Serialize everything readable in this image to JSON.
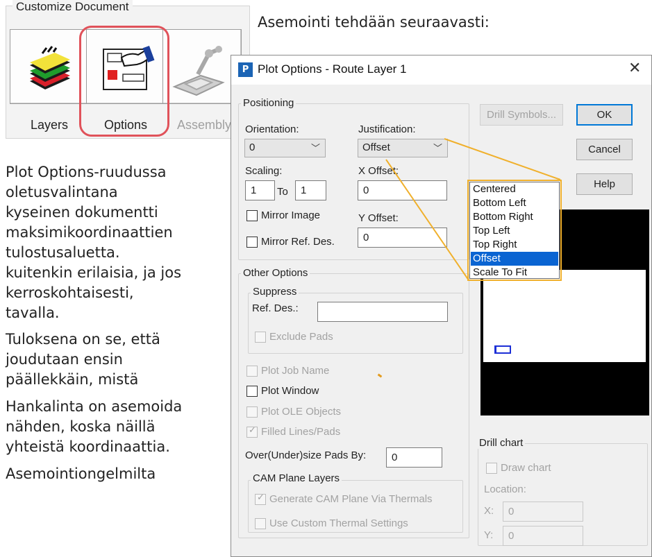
{
  "customize": {
    "title": "Customize Document",
    "buttons": [
      {
        "label": "Layers"
      },
      {
        "label": "Options"
      },
      {
        "label": "Assembly"
      }
    ]
  },
  "heading": "Asemointi tehdään seuraavasti:",
  "body_lines": [
    "Plot Options-ruudussa",
    "oletusvalintana",
    "kyseinen dokumentti",
    "maksimikoordinaattien",
    "tulostusaluetta.",
    "kuitenkin erilaisia, ja jos",
    "kerroskohtaisesti,",
    "tavalla.",
    "Tuloksena on se, että",
    "joudutaan ensin",
    "päällekkäin, mistä",
    "Hankalinta on asemoida",
    "nähden, koska näillä",
    "yhteistä koordinaattia.",
    "Asemointiongelmilta"
  ],
  "dialog": {
    "title": "Plot Options - Route Layer 1",
    "positioning": {
      "title": "Positioning",
      "orientation_label": "Orientation:",
      "orientation_value": "0",
      "justification_label": "Justification:",
      "justification_value": "Offset",
      "scaling_label": "Scaling:",
      "scale_from": "1",
      "to_label": "To",
      "scale_to": "1",
      "x_offset_label": "X Offset:",
      "x_offset_value": "0",
      "y_offset_label": "Y Offset:",
      "y_offset_value": "0",
      "mirror_image": "Mirror Image",
      "mirror_ref_des": "Mirror Ref. Des."
    },
    "other_options": {
      "title": "Other Options",
      "suppress_title": "Suppress",
      "ref_des_label": "Ref. Des.:",
      "ref_des_value": "",
      "exclude_pads": "Exclude Pads",
      "plot_job_name": "Plot Job Name",
      "plot_window": "Plot Window",
      "plot_ole_objects": "Plot OLE Objects",
      "filled_lines_pads": "Filled Lines/Pads",
      "oversize_label": "Over(Under)size Pads By:",
      "oversize_value": "0",
      "cam_title": "CAM Plane Layers",
      "generate_cam": "Generate CAM Plane Via Thermals",
      "custom_thermal": "Use Custom Thermal Settings"
    },
    "buttons": {
      "drill_symbols": "Drill Symbols...",
      "ok": "OK",
      "cancel": "Cancel",
      "help": "Help"
    },
    "drill_chart": {
      "title": "Drill chart",
      "draw_chart": "Draw chart",
      "location_label": "Location:",
      "x_label": "X:",
      "x_value": "0",
      "y_label": "Y:",
      "y_value": "0"
    },
    "justification_options": [
      "Centered",
      "Bottom Left",
      "Bottom Right",
      "Top Left",
      "Top Right",
      "Offset",
      "Scale To Fit"
    ],
    "justification_selected": "Offset"
  },
  "colors": {
    "highlight_ring": "#e0525a",
    "callout": "#f0b02c",
    "selection": "#0a64d2"
  }
}
